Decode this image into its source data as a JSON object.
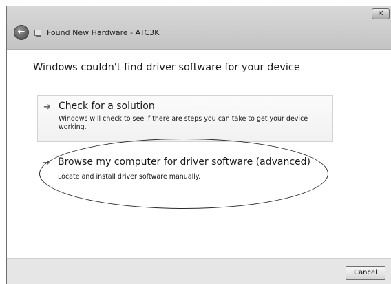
{
  "window": {
    "title": "Found New Hardware - ATC3K",
    "close_glyph": "✕"
  },
  "main": {
    "heading": "Windows couldn't find driver software for your device",
    "options": [
      {
        "title": "Check for a solution",
        "description": "Windows will check to see if there are steps you can take to get your device working.",
        "icon": "arrow-right-icon"
      },
      {
        "title": "Browse my computer for driver software (advanced)",
        "description": "Locate and install driver software manually.",
        "icon": "arrow-right-icon"
      }
    ]
  },
  "footer": {
    "cancel_label": "Cancel"
  }
}
